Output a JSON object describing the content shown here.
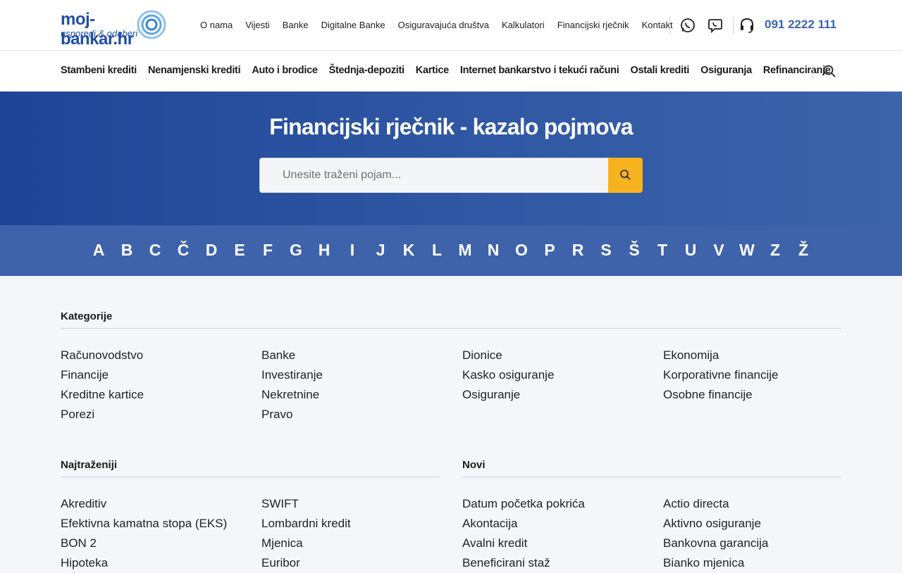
{
  "logo": {
    "main": "moj-bankar.hr",
    "sub": "usporedi & odaberi"
  },
  "topnav": [
    "O nama",
    "Vijesti",
    "Banke",
    "Digitalne Banke",
    "Osiguravajuća društva",
    "Kalkulatori",
    "Financijski rječnik",
    "Kontakt"
  ],
  "phone": "091 2222 111",
  "catnav": [
    "Stambeni krediti",
    "Nenamjenski krediti",
    "Auto i brodice",
    "Štednja-depoziti",
    "Kartice",
    "Internet bankarstvo i tekući računi",
    "Ostali krediti",
    "Osiguranja",
    "Refinanciranje"
  ],
  "hero": {
    "title": "Financijski rječnik - kazalo pojmova",
    "search_placeholder": "Unesite traženi pojam..."
  },
  "alphabet": [
    "A",
    "B",
    "C",
    "Č",
    "D",
    "E",
    "F",
    "G",
    "H",
    "I",
    "J",
    "K",
    "L",
    "M",
    "N",
    "O",
    "P",
    "R",
    "S",
    "Š",
    "T",
    "U",
    "V",
    "W",
    "Z",
    "Ž"
  ],
  "categories": {
    "title": "Kategorije",
    "columns": [
      [
        "Računovodstvo",
        "Financije",
        "Kreditne kartice",
        "Porezi"
      ],
      [
        "Banke",
        "Investiranje",
        "Nekretnine",
        "Pravo"
      ],
      [
        "Dionice",
        "Kasko osiguranje",
        "Osiguranje"
      ],
      [
        "Ekonomija",
        "Korporativne financije",
        "Osobne financije"
      ]
    ]
  },
  "most_searched": {
    "title": "Najtraženiji",
    "columns": [
      [
        "Akreditiv",
        "Efektivna kamatna stopa (EKS)",
        "BON 2",
        "Hipoteka"
      ],
      [
        "SWIFT",
        "Lombardni kredit",
        "Mjenica",
        "Euribor"
      ]
    ]
  },
  "new": {
    "title": "Novi",
    "columns": [
      [
        "Datum početka pokrića",
        "Akontacija",
        "Avalni kredit",
        "Beneficirani staž"
      ],
      [
        "Actio directa",
        "Aktivno osiguranje",
        "Bankovna garancija",
        "Bianko mjenica"
      ]
    ]
  },
  "colors": {
    "brand": "#1f4fa3",
    "accent": "#f7b21f",
    "alphabet_bg": "#3f63ab"
  }
}
